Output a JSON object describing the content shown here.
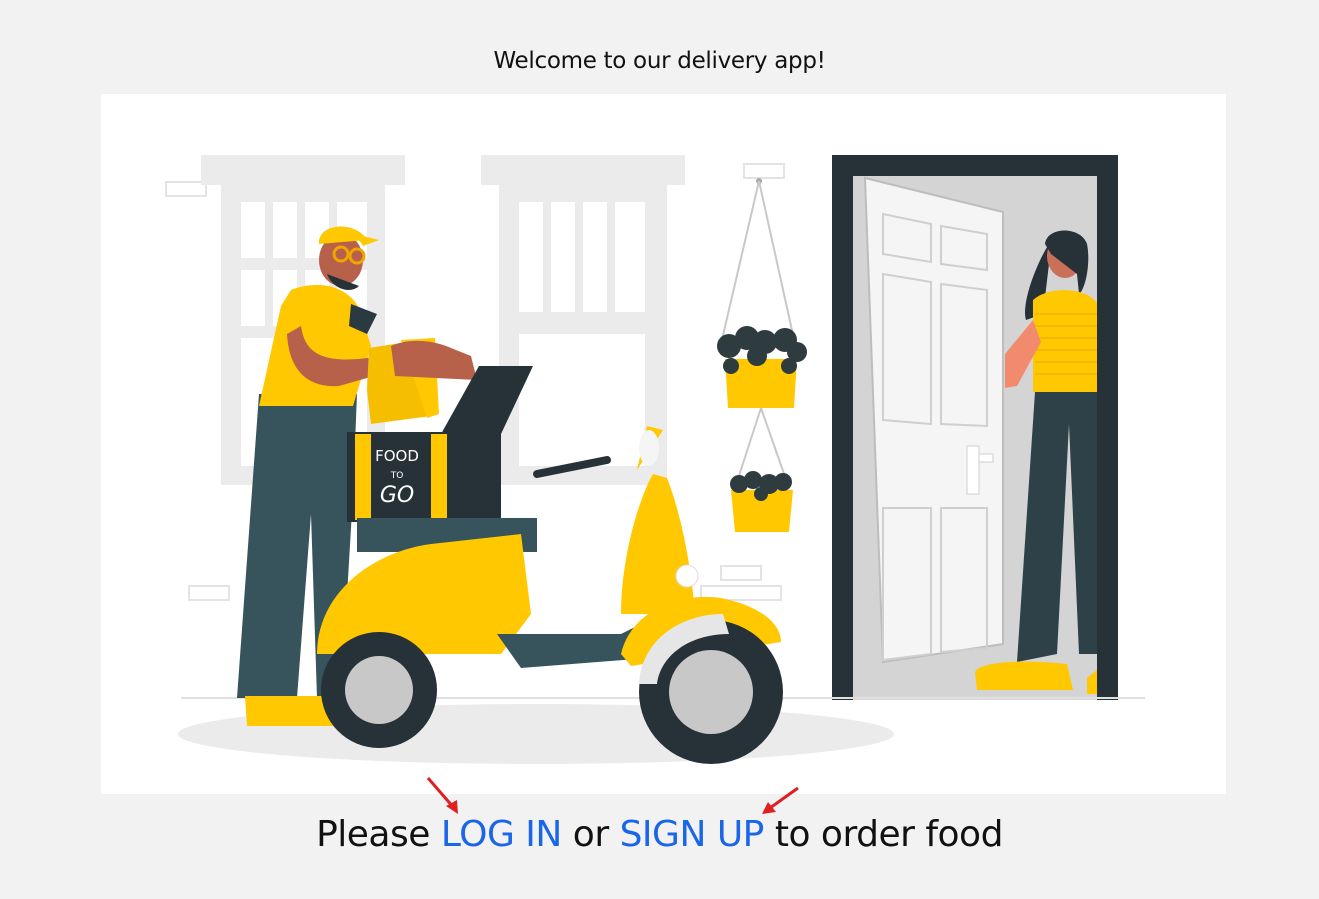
{
  "header": {
    "welcome_text": "Welcome to our delivery app!"
  },
  "illustration": {
    "box_label_top": "FOOD",
    "box_label_mid": "TO",
    "box_label_bottom": "GO"
  },
  "cta": {
    "prefix": "Please",
    "login_label": "LOG IN",
    "middle": "or",
    "signup_label": "SIGN UP",
    "suffix": "to order food"
  },
  "colors": {
    "background": "#f2f2f2",
    "link": "#1a66e8",
    "accent_yellow": "#ffc800",
    "dark_teal": "#263238",
    "arrow_red": "#e02020"
  }
}
